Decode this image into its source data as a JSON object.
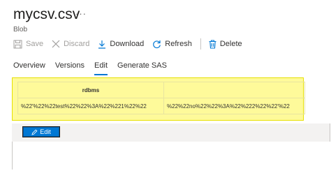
{
  "header": {
    "title": "mycsv.csv",
    "more": "···",
    "subtitle": "Blob"
  },
  "toolbar": {
    "save": "Save",
    "discard": "Discard",
    "download": "Download",
    "refresh": "Refresh",
    "delete": "Delete"
  },
  "tabs": [
    "Overview",
    "Versions",
    "Edit",
    "Generate SAS"
  ],
  "active_tab": "Edit",
  "grid": {
    "headers": [
      "rdbms",
      ""
    ],
    "rows": [
      [
        "%22'%22%22test%22%22%3A%22%221%22%22",
        "%22%22no%22%22%3A%22%222%22%22'%22"
      ]
    ]
  },
  "edit_button": "Edit",
  "colors": {
    "accent": "#0078d4",
    "highlight": "#fefa9a"
  }
}
